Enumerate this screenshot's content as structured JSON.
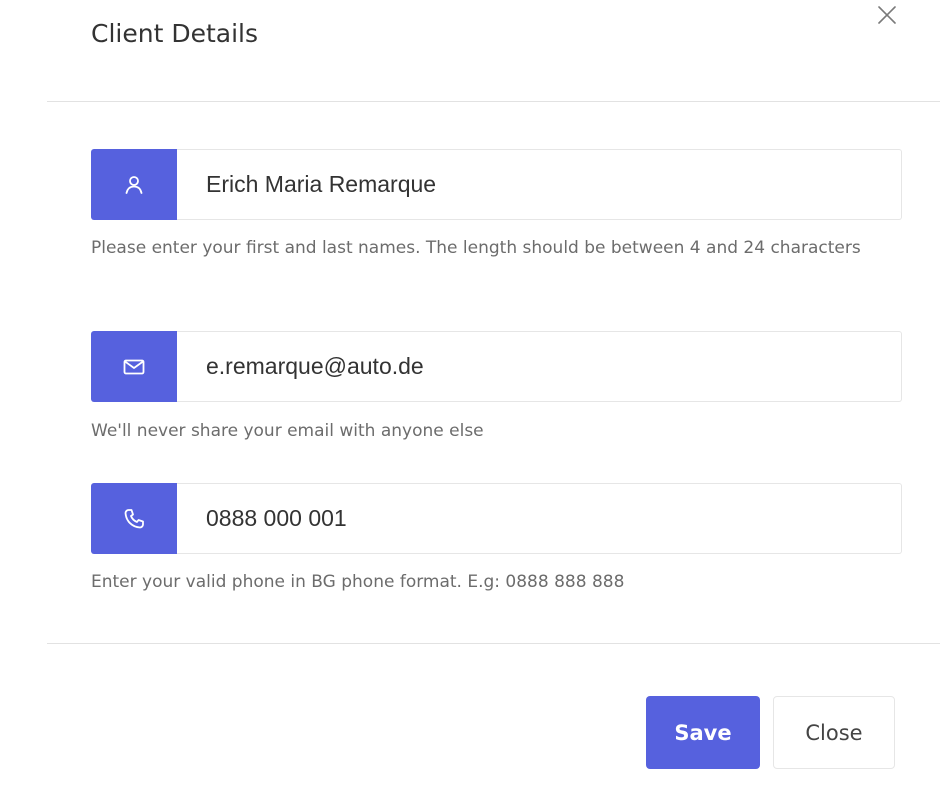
{
  "modal": {
    "title": "Client Details",
    "close_icon": "close-icon"
  },
  "colors": {
    "accent": "#5661de",
    "border": "#e6e6e6",
    "help_text": "#6c6c6c"
  },
  "fields": {
    "name": {
      "icon": "user-icon",
      "value": "Erich Maria Remarque",
      "help": "Please enter your first and last names. The length should be between 4 and 24 characters"
    },
    "email": {
      "icon": "mail-icon",
      "value": "e.remarque@auto.de",
      "help": "We'll never share your email with anyone else"
    },
    "phone": {
      "icon": "phone-icon",
      "value": "0888 000 001",
      "help": "Enter your valid phone in BG phone format. E.g: 0888 888 888"
    }
  },
  "footer": {
    "save_label": "Save",
    "close_label": "Close"
  }
}
